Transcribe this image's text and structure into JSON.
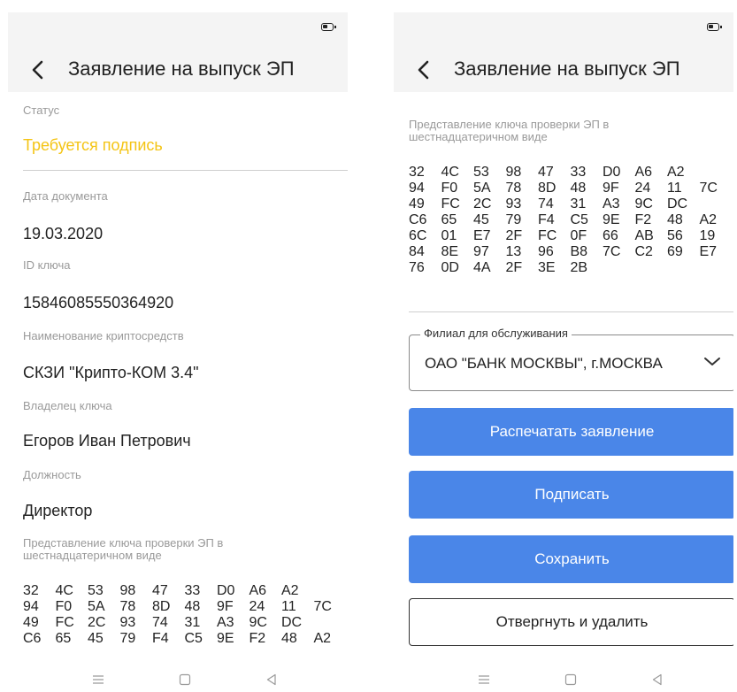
{
  "app": {
    "title": "Заявление на выпуск ЭП"
  },
  "fields": {
    "status": {
      "label": "Статус",
      "value": "Требуется подпись"
    },
    "date": {
      "label": "Дата документа",
      "value": "19.03.2020"
    },
    "key_id": {
      "label": "ID ключа",
      "value": "15846085550364920"
    },
    "crypto": {
      "label": "Наименование криптосредств",
      "value": "СКЗИ \"Крипто-КОМ 3.4\""
    },
    "owner": {
      "label": "Владелец ключа",
      "value": "Егоров Иван Петрович"
    },
    "position": {
      "label": "Должность",
      "value": "Директор"
    }
  },
  "key_representation": {
    "label": "Представление ключа проверки ЭП в шестнадцатеричном виде",
    "hex_rows": [
      [
        "32",
        "4C",
        "53",
        "98",
        "47",
        "33",
        "D0",
        "A6",
        "A2"
      ],
      [
        "94",
        "F0",
        "5A",
        "78",
        "8D",
        "48",
        "9F",
        "24",
        "11",
        "7C"
      ],
      [
        "49",
        "FC",
        "2C",
        "93",
        "74",
        "31",
        "A3",
        "9C",
        "DC"
      ],
      [
        "C6",
        "65",
        "45",
        "79",
        "F4",
        "C5",
        "9E",
        "F2",
        "48",
        "A2"
      ],
      [
        "6C",
        "01",
        "E7",
        "2F",
        "FC",
        "0F",
        "66",
        "AB",
        "56",
        "19"
      ],
      [
        "84",
        "8E",
        "97",
        "13",
        "96",
        "B8",
        "7C",
        "C2",
        "69",
        "E7"
      ],
      [
        "76",
        "0D",
        "4A",
        "2F",
        "3E",
        "2B"
      ]
    ]
  },
  "branch": {
    "label": "Филиал для обслуживания",
    "value": "ОАО \"БАНК МОСКВЫ\", г.МОСКВА"
  },
  "actions": {
    "print": "Распечатать заявление",
    "sign": "Подписать",
    "save": "Сохранить",
    "reject": "Отвергнуть и удалить"
  },
  "icons": {
    "back": "arrow-back-icon",
    "battery": "battery-icon",
    "dropdown": "chevron-down-icon",
    "nav": [
      "menu-icon",
      "home-icon",
      "back-triangle-icon"
    ]
  },
  "colors": {
    "status": "#f4c414",
    "primary": "#4a86e8",
    "header_bg": "#f4f4f4",
    "label": "#9a9a9a"
  }
}
